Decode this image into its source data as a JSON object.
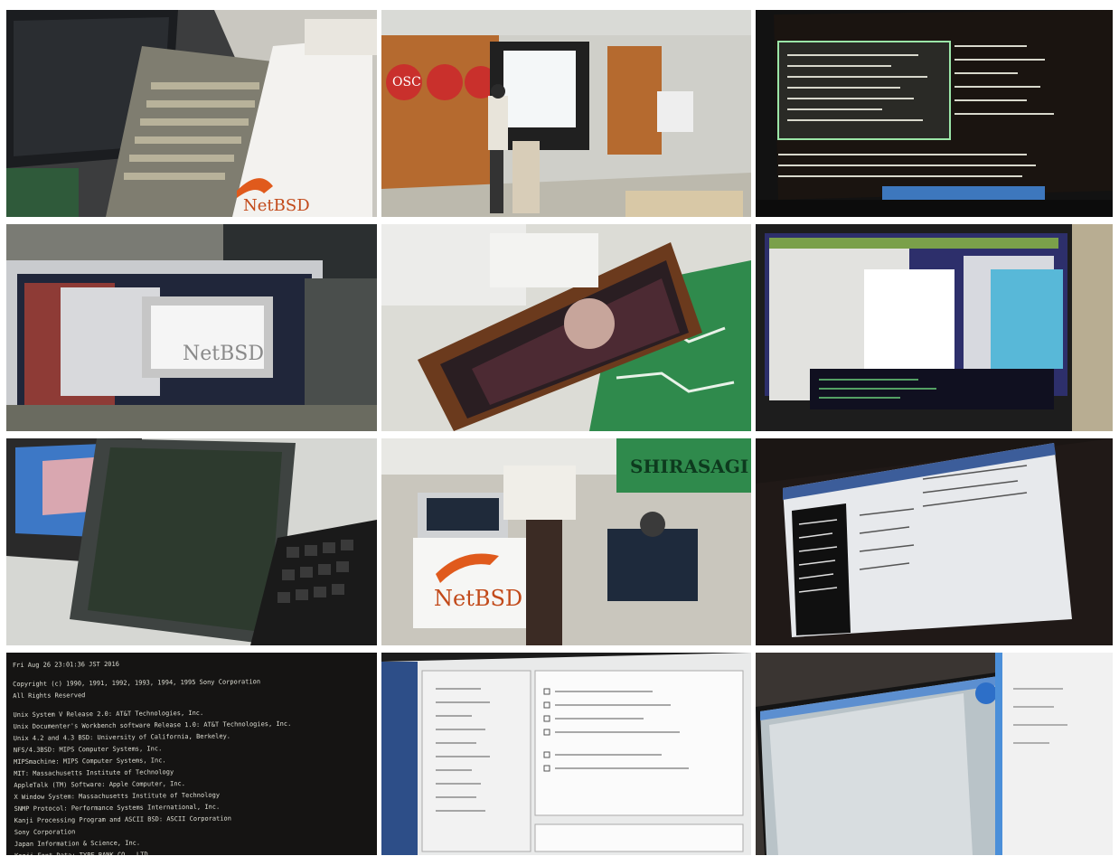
{
  "gallery": {
    "photos": [
      {
        "subject": "laptop-with-netbsd-sign",
        "sign_text": "NetBSD"
      },
      {
        "subject": "presentation-hall",
        "banner_text": "OSC"
      },
      {
        "subject": "monitor-console"
      },
      {
        "subject": "macbook-netbsd-screen",
        "screen_text": "NetBSD"
      },
      {
        "subject": "wooden-frame-display"
      },
      {
        "subject": "monitor-multiple-windows"
      },
      {
        "subject": "tablet-and-keyboard"
      },
      {
        "subject": "booth-netbsd-banner",
        "banner_text": "NetBSD",
        "sign_text": "SHIRASAGI"
      },
      {
        "subject": "japanese-installer-screen"
      },
      {
        "subject": "boot-console-screen",
        "console_lines": [
          "Fri Aug 26 23:01:36 JST 2016",
          "Copyright (c) 1990, 1991, 1992, 1993, 1994, 1995 Sony Corporation",
          "All Rights Reserved",
          "Unix System V Release 2.0: AT&T Technologies, Inc.",
          "Unix Documenter's Workbench software Release 1.0: AT&T Technologies, Inc.",
          "Unix 4.2 and 4.3 BSD: University of California, Berkeley.",
          "NFS/4.3BSD: MIPS Computer Systems, Inc.",
          "MIPSmachine: MIPS Computer Systems, Inc.",
          "MIT: Massachusetts Institute of Technology",
          "AppleTalk (TM) Software: Apple Computer, Inc.",
          "X Window System: Massachusetts Institute of Technology",
          "SNMP Protocol: Performance Systems International, Inc.",
          "Kanji Processing Program and ASCII BSD: ASCII Corporation",
          "Sony Corporation",
          "Japan Information & Science, Inc.",
          "Kanji Font Data: TYPE BANK CO., LTD."
        ]
      },
      {
        "subject": "installer-checkbox-screen"
      },
      {
        "subject": "monitor-desktop-panels"
      }
    ]
  },
  "colors": {
    "netbsd_orange": "#e05a1c",
    "terminal_green": "#9be6a8",
    "screen_blue": "#2d6fc8"
  }
}
